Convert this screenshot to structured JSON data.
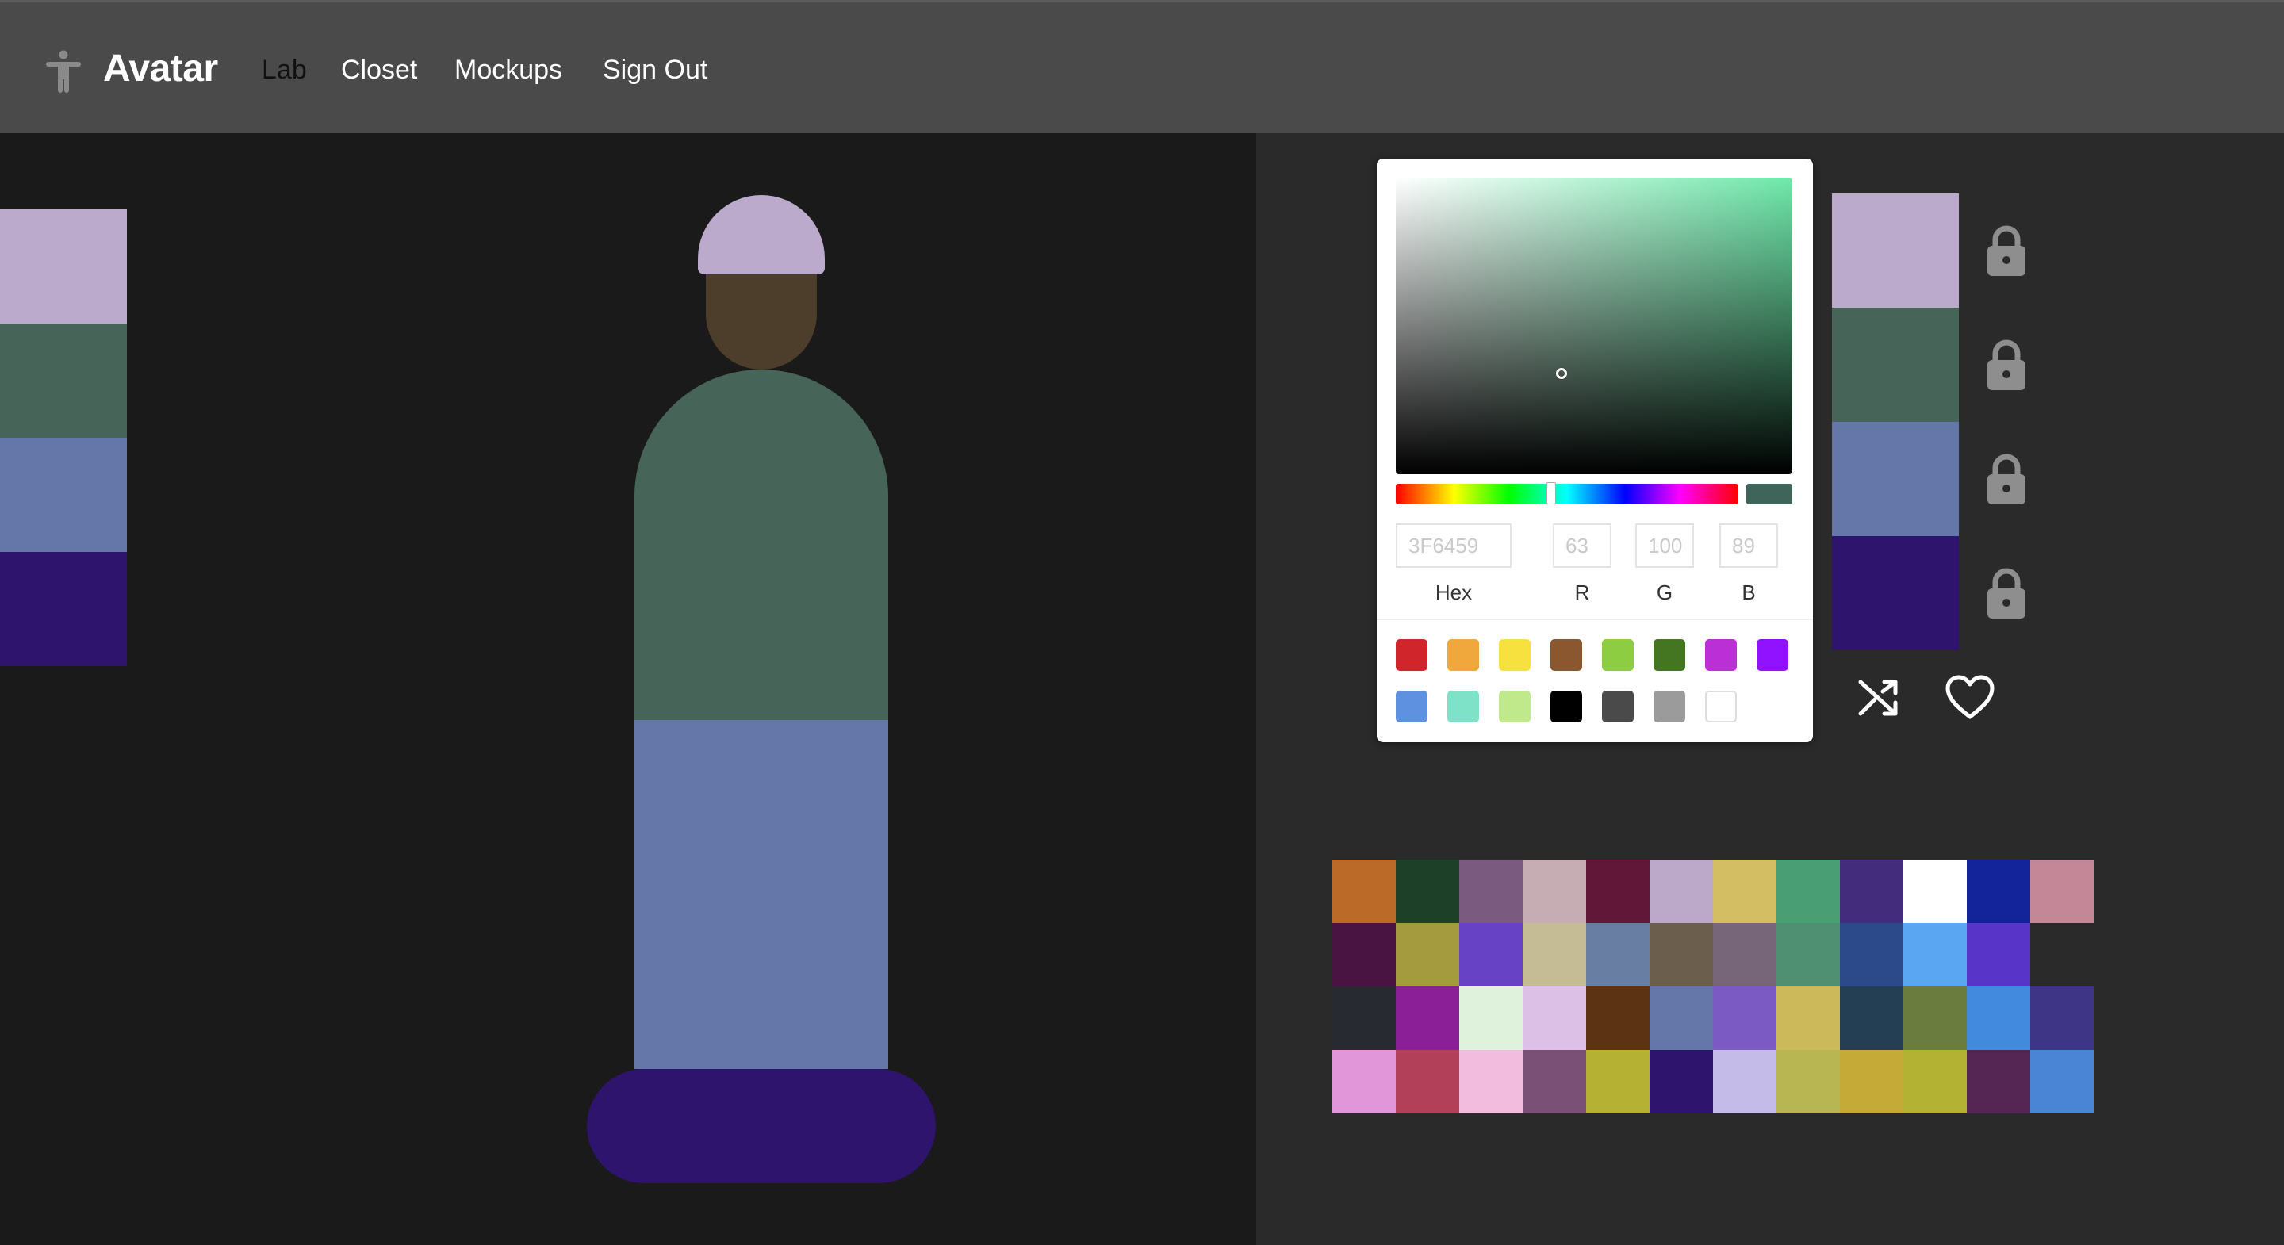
{
  "app": {
    "brand": "Avatar",
    "logo_icon": "accessibility-person-icon",
    "nav": [
      {
        "label": "Lab",
        "active": true
      },
      {
        "label": "Closet",
        "active": false
      },
      {
        "label": "Mockups",
        "active": false
      },
      {
        "label": "Sign Out",
        "active": false
      }
    ]
  },
  "avatar_colors": {
    "hat": "#bbaacb",
    "face": "#4c3e2b",
    "shirt": "#476459",
    "pants": "#6577a8",
    "shoes": "#2e146c"
  },
  "color_picker": {
    "hex_value": "3F6459",
    "r_value": "63",
    "g_value": "100",
    "b_value": "89",
    "hex_label": "Hex",
    "r_label": "R",
    "g_label": "G",
    "b_label": "B",
    "current_color": "#3f6459",
    "hue_color": "#6ee8aa",
    "presets": [
      "#d0262b",
      "#f0a83d",
      "#f7e13f",
      "#8a572e",
      "#8ccd41",
      "#447521",
      "#bb2fd6",
      "#9012fe",
      "#5e92e0",
      "#7ee2c8",
      "#bfe98b",
      "#000000",
      "#4a4a4a",
      "#9b9b9b",
      "#ffffff"
    ]
  },
  "slots": [
    {
      "name": "hat",
      "color": "#bbaacb",
      "locked": true
    },
    {
      "name": "shirt",
      "color": "#476459",
      "locked": true
    },
    {
      "name": "pants",
      "color": "#6577a8",
      "locked": true
    },
    {
      "name": "shoes",
      "color": "#2e146c",
      "locked": true
    }
  ],
  "actions": {
    "shuffle_icon": "shuffle-icon",
    "favorite_icon": "heart-icon"
  },
  "palette": [
    "#bb6a28",
    "#1c4128",
    "#7b5a80",
    "#c6adb3",
    "#611838",
    "#bca9c9",
    "#d4be63",
    "#4a9e73",
    "#442c7c",
    "#ffffff",
    "#13249a",
    "#c48797",
    "#4a1442",
    "#a49a3e",
    "#6842c4",
    "#c5bc96",
    "#687ea2",
    "#6b5e4c",
    "#776679",
    "#4f8f72",
    "#2c4a8a",
    "#5aa6f2",
    "#5835c8",
    null,
    "#272a30",
    "#8b1f97",
    "#dff2db",
    "#dcc0e6",
    "#5d3413",
    "#6577a8",
    "#7b5ac4",
    "#ccb95a",
    "#243f54",
    "#6a7d3e",
    "#428ade",
    "#3f3586",
    "#e096d8",
    "#b14058",
    "#f2bcdf",
    "#7b5077",
    "#b5b133",
    "#2e146c",
    "#c4bbe8",
    "#b8b653",
    "#c5aa37",
    "#b3b232",
    "#552553",
    "#4a84d4"
  ]
}
